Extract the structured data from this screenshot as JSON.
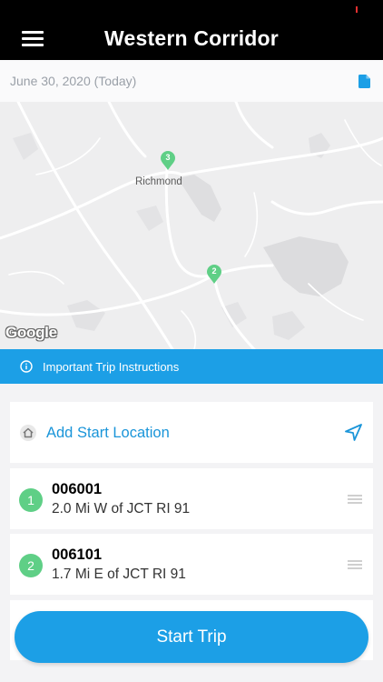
{
  "header": {
    "title": "Western Corridor",
    "menu_icon": "hamburger-menu-icon"
  },
  "date": {
    "label": "June 30, 2020 (Today)",
    "icon": "document-icon"
  },
  "map": {
    "city_label": "Richmond",
    "attribution": "Google",
    "markers": [
      {
        "number": "3",
        "color": "#5fcf86"
      },
      {
        "number": "2",
        "color": "#5fcf86"
      }
    ]
  },
  "info_banner": {
    "label": "Important Trip Instructions",
    "icon": "info-circle-icon",
    "color": "#1c9fe6"
  },
  "start_location": {
    "label": "Add Start Location",
    "icon": "home-icon",
    "action_icon": "navigation-arrow-icon"
  },
  "stops": [
    {
      "number": "1",
      "code": "006001",
      "description": "2.0 Mi W of JCT RI 91"
    },
    {
      "number": "2",
      "code": "006101",
      "description": "1.7 Mi E of JCT RI 91"
    }
  ],
  "primary_action": {
    "label": "Start Trip",
    "color": "#1c9fe6"
  }
}
